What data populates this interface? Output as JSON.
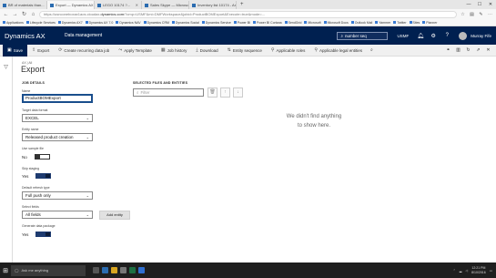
{
  "browser": {
    "tabs": [
      {
        "title": "BR of materials than...",
        "active": false
      },
      {
        "title": "Export — Dynamics AX",
        "active": true
      },
      {
        "title": "LEGO 10174 ?...",
        "active": false
      },
      {
        "title": "Sales Skype — Microsoft...",
        "active": false
      },
      {
        "title": "Inventory list 10174 - Ange...",
        "active": false
      }
    ],
    "new_tab": "+",
    "url_prefix": "https://usnconeboxax1aos.cloudax.",
    "url_domain": "dynamics.com",
    "url_suffix": "/?cmp=USMF&mi=DMFWorkspace&jobid=ProductBOMExport&Execute=true&mode=...",
    "bookmarks": [
      "Applications",
      "Lifecycle Services",
      "Dynamics AX7",
      "Dynamics AX 7.0",
      "Dynamics NAV",
      "Dynamics CRM",
      "Dynamics Social",
      "Dynamics Service",
      "Power BI",
      "Power BI Cortana",
      "SendGrid",
      "Microsoft",
      "Microsoft Docs",
      "Outlook Mail",
      "Yammer",
      "Twitter",
      "Sites",
      "Planner"
    ]
  },
  "ax": {
    "brand": "Dynamics AX",
    "module": "Data management",
    "search_placeholder": "number seq",
    "company": "USMF",
    "user": "Murray Fife"
  },
  "actions": [
    {
      "label": "Save",
      "icon": "save-icon",
      "primary": true
    },
    {
      "label": "Export",
      "icon": "export-icon"
    },
    {
      "label": "Create recurring data job",
      "icon": "recurring-icon"
    },
    {
      "label": "Apply Template",
      "icon": "template-icon"
    },
    {
      "label": "Job history",
      "icon": "history-icon"
    },
    {
      "label": "Download",
      "icon": "download-icon"
    },
    {
      "label": "Entity sequence",
      "icon": "sequence-icon"
    },
    {
      "label": "Applicable roles",
      "icon": "roles-icon"
    },
    {
      "label": "Applicable legal entities",
      "icon": "entities-icon"
    }
  ],
  "page": {
    "breadcrumb": "AX | All",
    "title": "Export"
  },
  "job_details": {
    "section_title": "JOB DETAILS",
    "name_label": "Name",
    "name_value": "ProductBOMExport",
    "format_label": "Target data format",
    "format_value": "EXCEL",
    "entity_label": "Entity name",
    "entity_value": "Released product creation",
    "sample_label": "Use sample file",
    "sample_value": "No",
    "staging_label": "Skip staging",
    "staging_value": "Yes",
    "refresh_label": "Default refresh type",
    "refresh_value": "Full push only",
    "fields_label": "Select fields",
    "fields_value": "All fields",
    "add_entity": "Add entity",
    "package_label": "Generate data package",
    "package_value": "Yes"
  },
  "files": {
    "section_title": "SELECTED FILES AND ENTITIES",
    "filter_placeholder": "Filter",
    "empty_line1": "We didn't find anything",
    "empty_line2": "to show here."
  },
  "taskbar": {
    "search_placeholder": "Ask me anything",
    "time": "12:21 PM",
    "date": "8/10/2016"
  }
}
